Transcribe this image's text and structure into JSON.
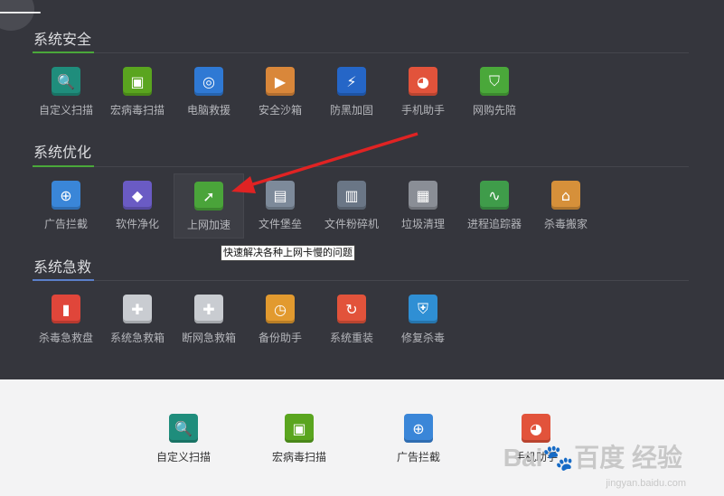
{
  "nav": {
    "back_icon": "arrow-left-icon",
    "back_glyph": "🡐"
  },
  "sections": [
    {
      "title": "系统安全",
      "items": [
        {
          "label": "自定义扫描",
          "icon": "search-icon",
          "color": "#1f8d7c",
          "glyph": "🔍"
        },
        {
          "label": "宏病毒扫描",
          "icon": "scan-frame-icon",
          "color": "#5aa51f",
          "glyph": "▣"
        },
        {
          "label": "电脑救援",
          "icon": "lifebuoy-icon",
          "color": "#2f79d4",
          "glyph": "◎"
        },
        {
          "label": "安全沙箱",
          "icon": "sandbox-icon",
          "color": "#d9873a",
          "glyph": "▶"
        },
        {
          "label": "防黑加固",
          "icon": "lightning-shield-icon",
          "color": "#2566c7",
          "glyph": "⚡"
        },
        {
          "label": "手机助手",
          "icon": "colorful-ball-icon",
          "color": "#e2533b",
          "glyph": "◕"
        },
        {
          "label": "网购先陪",
          "icon": "shopping-shield-icon",
          "color": "#4aa83a",
          "glyph": "⛉"
        }
      ]
    },
    {
      "title": "系统优化",
      "items": [
        {
          "label": "广告拦截",
          "icon": "target-icon",
          "color": "#3a86d8",
          "glyph": "⊕"
        },
        {
          "label": "软件净化",
          "icon": "layers-icon",
          "color": "#6a5bc4",
          "glyph": "◆"
        },
        {
          "label": "上网加速",
          "icon": "rocket-icon",
          "color": "#4aa43a",
          "glyph": "➚"
        },
        {
          "label": "文件堡垒",
          "icon": "file-fortress-icon",
          "color": "#7d8a9a",
          "glyph": "▤"
        },
        {
          "label": "文件粉碎机",
          "icon": "shredder-icon",
          "color": "#6a7686",
          "glyph": "▥"
        },
        {
          "label": "垃圾清理",
          "icon": "broom-icon",
          "color": "#8a8e96",
          "glyph": "▦"
        },
        {
          "label": "进程追踪器",
          "icon": "pulse-icon",
          "color": "#3f9c4a",
          "glyph": "∿"
        },
        {
          "label": "杀毒搬家",
          "icon": "house-icon",
          "color": "#d6903a",
          "glyph": "⌂"
        }
      ]
    },
    {
      "title": "系统急救",
      "items": [
        {
          "label": "杀毒急救盘",
          "icon": "usb-drive-icon",
          "color": "#e0463a",
          "glyph": "▮"
        },
        {
          "label": "系统急救箱",
          "icon": "first-aid-kit-icon",
          "color": "#c9ccd1",
          "glyph": "✚"
        },
        {
          "label": "断网急救箱",
          "icon": "network-aid-kit-icon",
          "color": "#c9ccd1",
          "glyph": "✚"
        },
        {
          "label": "备份助手",
          "icon": "backup-clock-icon",
          "color": "#e29a2f",
          "glyph": "◷"
        },
        {
          "label": "系统重装",
          "icon": "reinstall-icon",
          "color": "#e2533b",
          "glyph": "↻"
        },
        {
          "label": "修复杀毒",
          "icon": "repair-shield-icon",
          "color": "#2f8fd4",
          "glyph": "⛨"
        }
      ]
    }
  ],
  "tooltip": {
    "text": "快速解决各种上网卡慢的问题"
  },
  "shortcuts": [
    {
      "label": "自定义扫描",
      "icon": "search-icon",
      "color": "#1f8d7c",
      "glyph": "🔍"
    },
    {
      "label": "宏病毒扫描",
      "icon": "scan-frame-icon",
      "color": "#5aa51f",
      "glyph": "▣"
    },
    {
      "label": "广告拦截",
      "icon": "target-icon",
      "color": "#3a86d8",
      "glyph": "⊕"
    },
    {
      "label": "手机助手",
      "icon": "colorful-ball-icon",
      "color": "#e2533b",
      "glyph": "◕"
    }
  ],
  "watermark": {
    "brand": "Bai🐾百度 经验",
    "url": "jingyan.baidu.com"
  },
  "colors": {
    "accent_green": "#4aa83a",
    "accent_blue": "#5b7fc9",
    "annotation_arrow": "#e02323"
  }
}
